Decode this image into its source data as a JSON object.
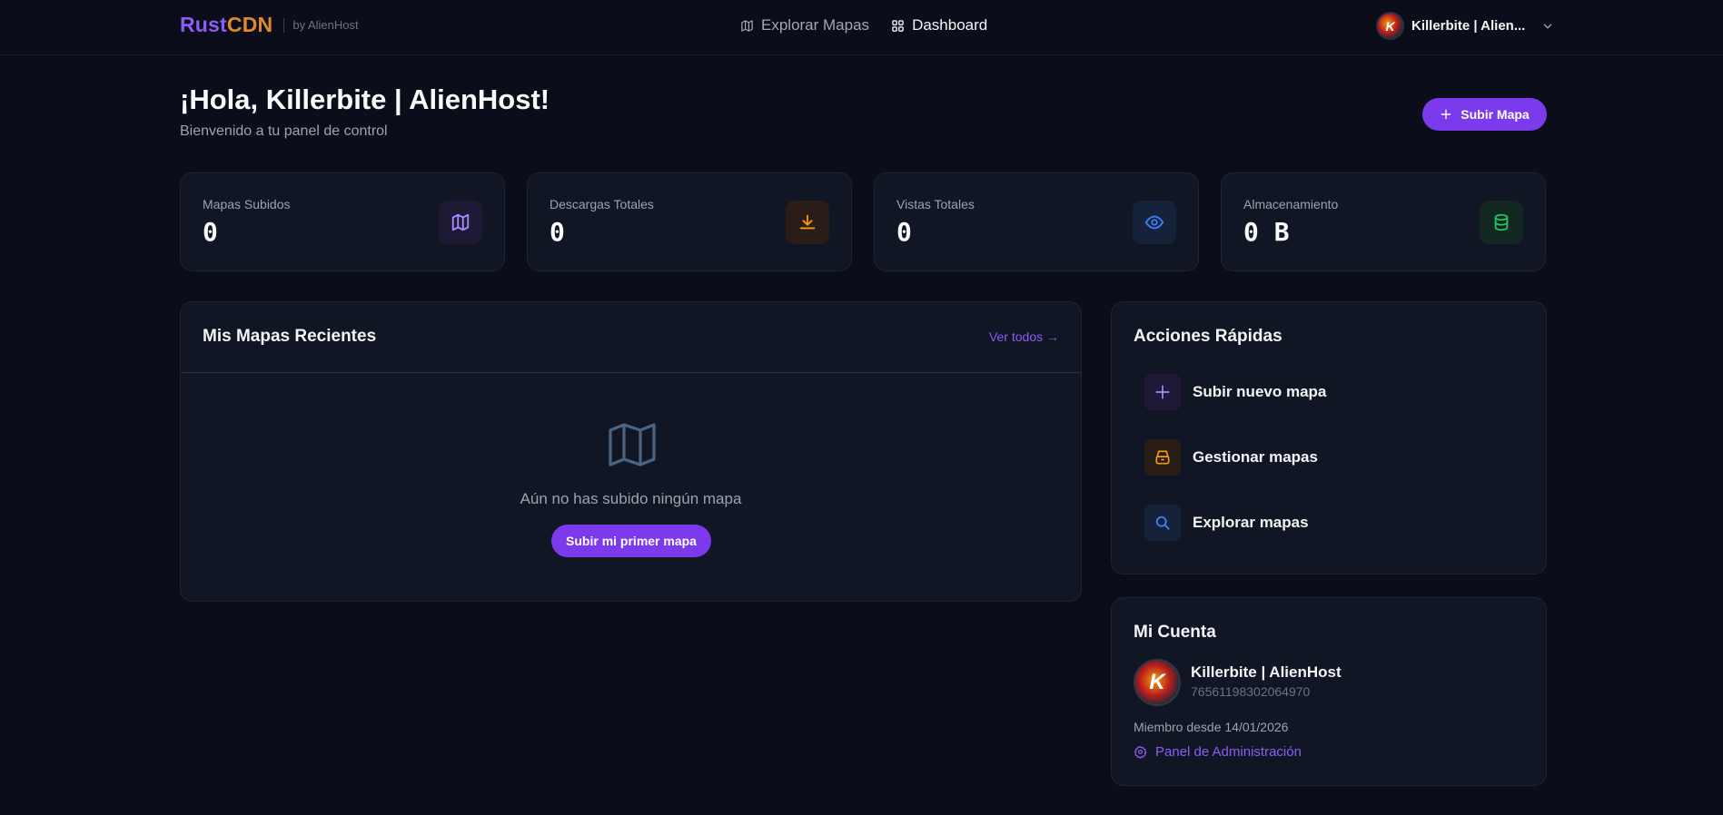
{
  "header": {
    "brand_part1": "Rust",
    "brand_part2": "CDN",
    "brand_by": "by AlienHost",
    "nav": [
      {
        "label": "Explorar Mapas",
        "icon": "map-icon",
        "active": false
      },
      {
        "label": "Dashboard",
        "icon": "grid-icon",
        "active": true
      }
    ],
    "user_name": "Killerbite | Alien...",
    "avatar_letter": "K"
  },
  "greeting": {
    "title": "¡Hola, Killerbite | AlienHost!",
    "subtitle": "Bienvenido a tu panel de control",
    "upload_button": "Subir Mapa"
  },
  "stats": [
    {
      "label": "Mapas Subidos",
      "value": "0",
      "icon": "map-icon",
      "color": "#a78bfa",
      "bg": "#1e1a36"
    },
    {
      "label": "Descargas Totales",
      "value": "0",
      "icon": "download-icon",
      "color": "#f59e0b",
      "bg": "#2a1d18"
    },
    {
      "label": "Vistas Totales",
      "value": "0",
      "icon": "eye-icon",
      "color": "#3b82f6",
      "bg": "#16213a"
    },
    {
      "label": "Almacenamiento",
      "value": "0 B",
      "icon": "database-icon",
      "color": "#22c55e",
      "bg": "#13261f"
    }
  ],
  "recent": {
    "title": "Mis Mapas Recientes",
    "see_all": "Ver todos →",
    "empty_text": "Aún no has subido ningún mapa",
    "empty_button": "Subir mi primer mapa"
  },
  "quick_actions": {
    "title": "Acciones Rápidas",
    "items": [
      {
        "label": "Subir nuevo mapa",
        "icon": "plus-icon",
        "color": "#a78bfa",
        "bg": "#1e1a36"
      },
      {
        "label": "Gestionar mapas",
        "icon": "archive-icon",
        "color": "#f59e0b",
        "bg": "#2a1d18"
      },
      {
        "label": "Explorar mapas",
        "icon": "search-icon",
        "color": "#3b82f6",
        "bg": "#16213a"
      }
    ]
  },
  "account": {
    "title": "Mi Cuenta",
    "name": "Killerbite | AlienHost",
    "steam_id": "76561198302064970",
    "member_since": "Miembro desde 14/01/2026",
    "admin_link": "Panel de Administración",
    "avatar_letter": "K"
  },
  "colors": {
    "accent": "#7c3aed",
    "background": "#0b0e1a",
    "card": "#111624"
  }
}
